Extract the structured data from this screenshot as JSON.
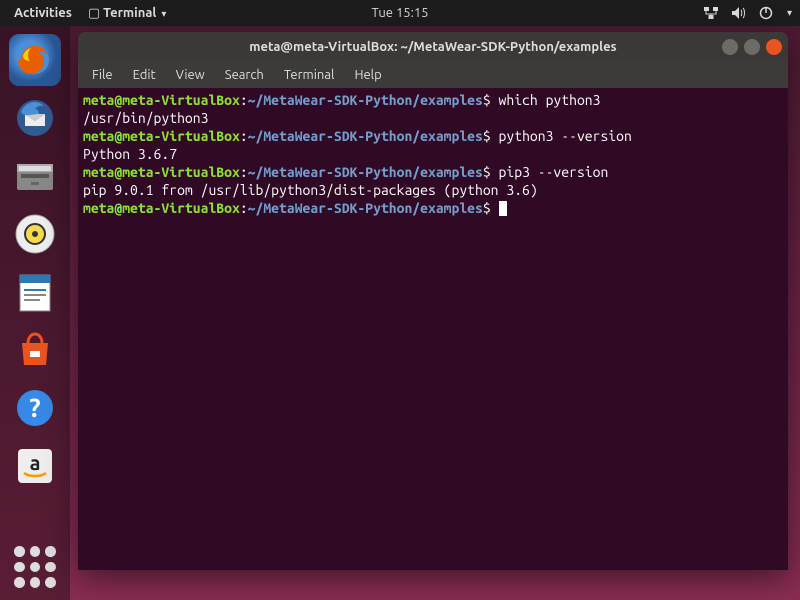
{
  "topbar": {
    "activities": "Activities",
    "app_label": "Terminal",
    "clock": "Tue 15:15"
  },
  "launcher": {
    "apps": [
      "firefox",
      "thunderbird",
      "files",
      "rhythmbox",
      "writer",
      "software",
      "help",
      "amazon"
    ]
  },
  "window": {
    "title": "meta@meta-VirtualBox: ~/MetaWear-SDK-Python/examples"
  },
  "menus": {
    "file": "File",
    "edit": "Edit",
    "view": "View",
    "search": "Search",
    "terminal": "Terminal",
    "help": "Help"
  },
  "prompt": {
    "user_host": "meta@meta-VirtualBox",
    "colon": ":",
    "path": "~/MetaWear-SDK-Python/examples",
    "dollar": "$"
  },
  "lines": [
    {
      "cmd": "which python3",
      "out": "/usr/bin/python3"
    },
    {
      "cmd": "python3 --version",
      "out": "Python 3.6.7"
    },
    {
      "cmd": "pip3 --version",
      "out": "pip 9.0.1 from /usr/lib/python3/dist-packages (python 3.6)"
    },
    {
      "cmd": "",
      "out": null
    }
  ]
}
